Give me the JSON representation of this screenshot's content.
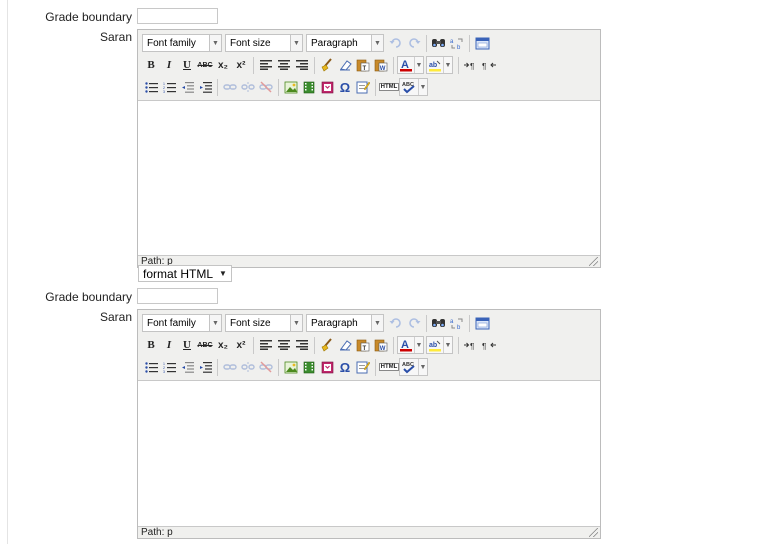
{
  "form": {
    "boundary_label": "Grade boundary",
    "saran_label": "Saran"
  },
  "toolbar": {
    "font_family": "Font family",
    "font_size": "Font size",
    "paragraph": "Paragraph",
    "bold": "B",
    "italic": "I",
    "underline": "U",
    "strike": "ABC",
    "subscript": "x₂",
    "superscript": "x²",
    "omega": "Ω",
    "html": "HTML"
  },
  "editor": {
    "path_label": "Path: p"
  },
  "format_select": {
    "value": "format HTML"
  },
  "colors": {
    "editor_border": "#bcbcbc",
    "toolbar_bg": "#f0f0ee",
    "text_color_red": "#cc0000",
    "highlight_yellow": "#ffeb3b"
  }
}
